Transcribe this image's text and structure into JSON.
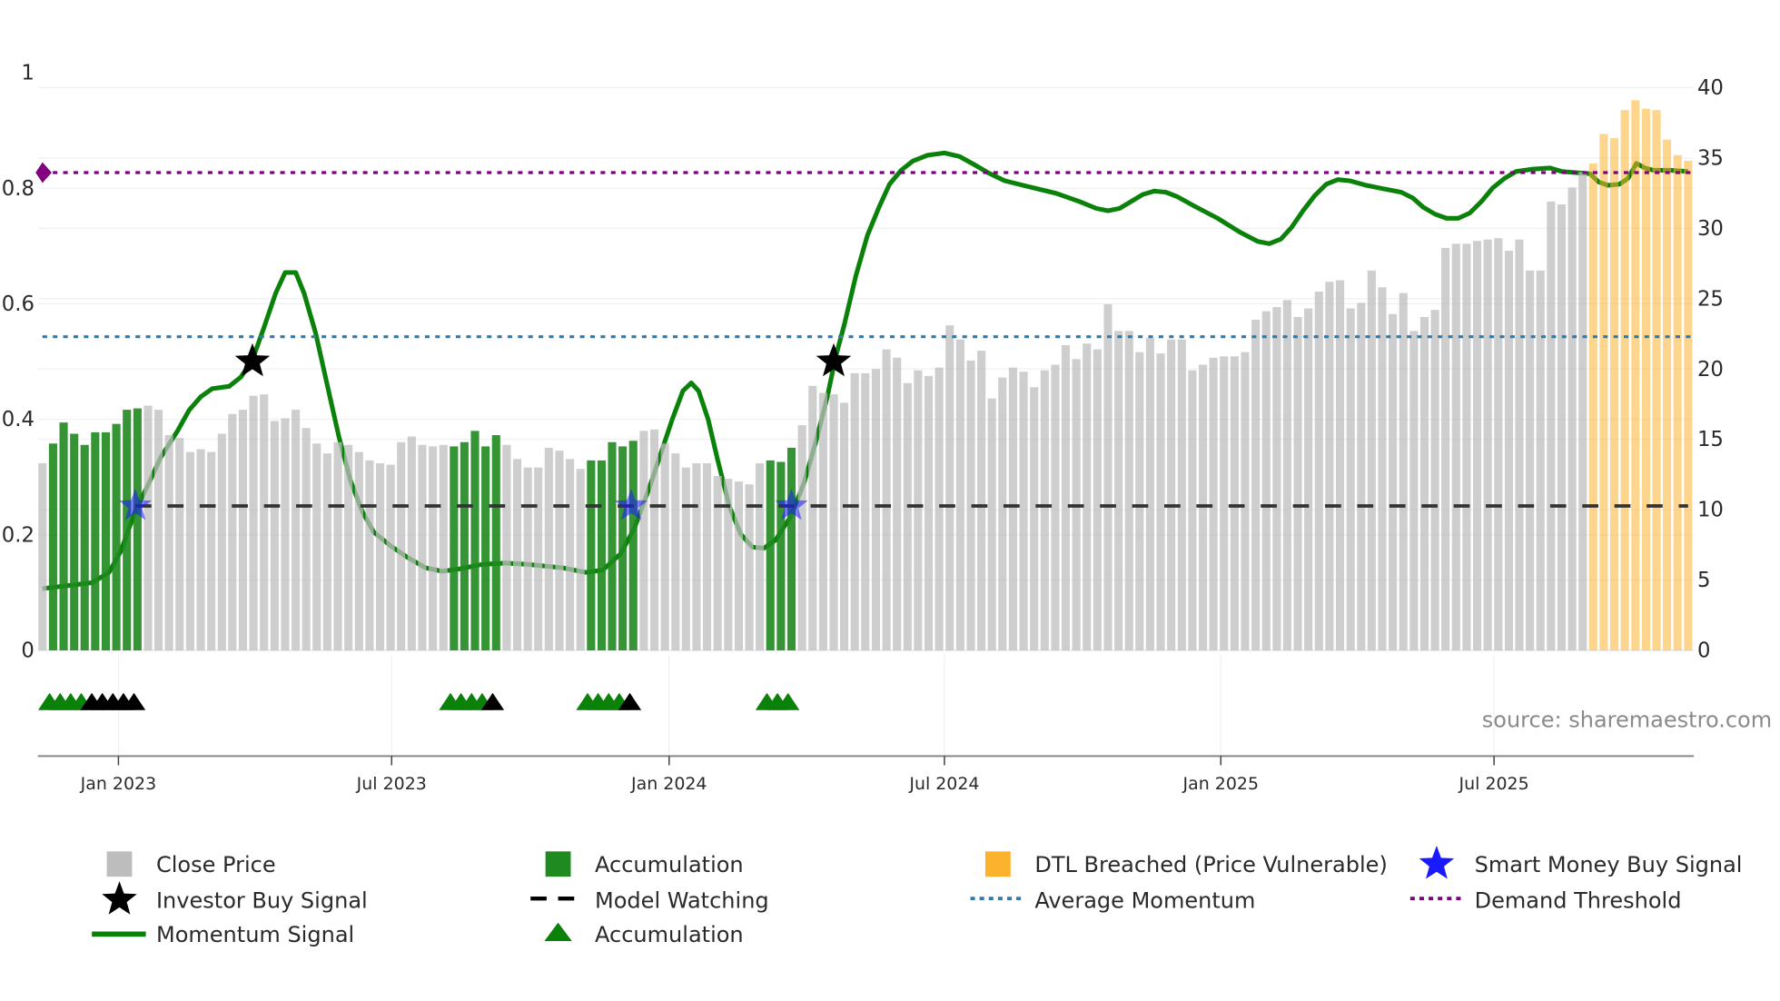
{
  "chart_data": {
    "type": "bar",
    "x_unit": "week index (1 = first weekly bar)",
    "left_axis": {
      "range": [
        0,
        1
      ],
      "ticks": [
        "0",
        "0.2",
        "0.4",
        "0.6",
        "0.8",
        "1"
      ]
    },
    "right_axis": {
      "range": [
        0,
        40
      ],
      "ticks": [
        "0",
        "5",
        "10",
        "15",
        "20",
        "25",
        "30",
        "35",
        "40"
      ]
    },
    "x_ticks": [
      {
        "label": "Jan 2023",
        "x": 8.2
      },
      {
        "label": "Jul 2023",
        "x": 34.1
      },
      {
        "label": "Jan 2024",
        "x": 60.4
      },
      {
        "label": "Jul 2024",
        "x": 86.5
      },
      {
        "label": "Jan 2025",
        "x": 112.7
      },
      {
        "label": "Jul 2025",
        "x": 138.6
      }
    ],
    "close_price": [
      13.3,
      14.7,
      16.2,
      15.4,
      14.6,
      15.5,
      15.5,
      16.1,
      17.1,
      17.2,
      17.4,
      17.1,
      15.3,
      15.1,
      14.1,
      14.3,
      14.1,
      15.4,
      16.8,
      17.1,
      18.1,
      18.2,
      16.3,
      16.5,
      17.1,
      15.8,
      14.7,
      14.0,
      14.8,
      14.6,
      14.1,
      13.5,
      13.3,
      13.2,
      14.8,
      15.2,
      14.6,
      14.5,
      14.6,
      14.5,
      14.8,
      15.6,
      14.5,
      15.3,
      14.6,
      13.6,
      13.0,
      13.0,
      14.4,
      14.2,
      13.6,
      12.9,
      13.5,
      13.5,
      14.8,
      14.5,
      14.9,
      15.6,
      15.7,
      14.7,
      14.0,
      13.0,
      13.3,
      13.3,
      12.4,
      12.2,
      12.0,
      11.8,
      13.3,
      13.5,
      13.4,
      14.4,
      16.0,
      18.8,
      18.3,
      18.2,
      17.6,
      19.7,
      19.7,
      20.0,
      21.4,
      20.8,
      19.0,
      19.9,
      19.5,
      20.1,
      23.1,
      22.1,
      20.6,
      21.3,
      17.9,
      19.4,
      20.1,
      19.8,
      18.7,
      19.9,
      20.3,
      21.7,
      20.7,
      21.8,
      21.4,
      24.6,
      22.7,
      22.7,
      21.2,
      22.2,
      21.1,
      22.1,
      22.1,
      19.9,
      20.3,
      20.8,
      20.9,
      20.9,
      21.2,
      23.5,
      24.1,
      24.4,
      24.9,
      23.7,
      24.3,
      25.5,
      26.2,
      26.3,
      24.3,
      24.7,
      27.0,
      25.8,
      23.9,
      25.4,
      22.7,
      23.7,
      24.2,
      28.6,
      28.9,
      28.9,
      29.1,
      29.2,
      29.3,
      28.4,
      29.2,
      27.0,
      27.0,
      31.9,
      31.7,
      32.9,
      34.0,
      34.6,
      36.7,
      36.4,
      38.4,
      39.1,
      38.5,
      38.4,
      36.3,
      35.2,
      34.8
    ],
    "accumulation_weeks": [
      [
        2,
        10
      ],
      [
        40,
        44
      ],
      [
        53,
        57
      ],
      [
        70,
        72
      ]
    ],
    "dtl_breached_weeks": [
      [
        148,
        157
      ]
    ],
    "momentum_signal": [
      [
        1,
        0.107
      ],
      [
        5.7,
        0.117
      ],
      [
        7.3,
        0.135
      ],
      [
        8.4,
        0.171
      ],
      [
        9.8,
        0.241
      ],
      [
        11.1,
        0.29
      ],
      [
        12.2,
        0.334
      ],
      [
        13.8,
        0.38
      ],
      [
        14.9,
        0.416
      ],
      [
        16,
        0.439
      ],
      [
        17.1,
        0.453
      ],
      [
        18.7,
        0.457
      ],
      [
        19.8,
        0.473
      ],
      [
        20.9,
        0.503
      ],
      [
        22,
        0.559
      ],
      [
        23.1,
        0.618
      ],
      [
        24,
        0.654
      ],
      [
        25,
        0.654
      ],
      [
        25.8,
        0.618
      ],
      [
        26.9,
        0.549
      ],
      [
        28,
        0.459
      ],
      [
        29.1,
        0.37
      ],
      [
        30.2,
        0.294
      ],
      [
        31.3,
        0.241
      ],
      [
        32.4,
        0.205
      ],
      [
        34,
        0.181
      ],
      [
        35.6,
        0.161
      ],
      [
        37.3,
        0.143
      ],
      [
        38.9,
        0.137
      ],
      [
        40.5,
        0.141
      ],
      [
        42.7,
        0.149
      ],
      [
        44.9,
        0.151
      ],
      [
        47,
        0.149
      ],
      [
        50.3,
        0.143
      ],
      [
        52.5,
        0.135
      ],
      [
        54.1,
        0.139
      ],
      [
        55.8,
        0.167
      ],
      [
        57.1,
        0.211
      ],
      [
        58.5,
        0.28
      ],
      [
        59.6,
        0.34
      ],
      [
        60.7,
        0.4
      ],
      [
        61.7,
        0.449
      ],
      [
        62.5,
        0.463
      ],
      [
        63.2,
        0.449
      ],
      [
        64.1,
        0.4
      ],
      [
        65,
        0.33
      ],
      [
        66.1,
        0.25
      ],
      [
        67.2,
        0.201
      ],
      [
        68.3,
        0.179
      ],
      [
        69.4,
        0.177
      ],
      [
        70.5,
        0.191
      ],
      [
        71.9,
        0.231
      ],
      [
        73.2,
        0.29
      ],
      [
        74.3,
        0.36
      ],
      [
        75.4,
        0.439
      ],
      [
        76.2,
        0.509
      ],
      [
        77,
        0.563
      ],
      [
        78.1,
        0.648
      ],
      [
        79.2,
        0.718
      ],
      [
        80.3,
        0.767
      ],
      [
        81.3,
        0.807
      ],
      [
        82.4,
        0.831
      ],
      [
        83.5,
        0.847
      ],
      [
        84.9,
        0.857
      ],
      [
        86.5,
        0.861
      ],
      [
        87.9,
        0.855
      ],
      [
        89.5,
        0.839
      ],
      [
        90.6,
        0.827
      ],
      [
        92.2,
        0.813
      ],
      [
        94.4,
        0.803
      ],
      [
        97.1,
        0.791
      ],
      [
        99.3,
        0.777
      ],
      [
        100.9,
        0.765
      ],
      [
        102,
        0.761
      ],
      [
        103.1,
        0.765
      ],
      [
        104.2,
        0.777
      ],
      [
        105.3,
        0.789
      ],
      [
        106.4,
        0.795
      ],
      [
        107.5,
        0.793
      ],
      [
        108.6,
        0.785
      ],
      [
        110.2,
        0.769
      ],
      [
        112.4,
        0.748
      ],
      [
        114.5,
        0.724
      ],
      [
        116.2,
        0.708
      ],
      [
        117.3,
        0.704
      ],
      [
        118.4,
        0.712
      ],
      [
        119.4,
        0.732
      ],
      [
        120.5,
        0.761
      ],
      [
        121.6,
        0.787
      ],
      [
        122.7,
        0.807
      ],
      [
        123.8,
        0.815
      ],
      [
        124.9,
        0.813
      ],
      [
        126.5,
        0.805
      ],
      [
        128.1,
        0.799
      ],
      [
        129.8,
        0.793
      ],
      [
        130.9,
        0.783
      ],
      [
        131.9,
        0.767
      ],
      [
        133,
        0.755
      ],
      [
        134.1,
        0.748
      ],
      [
        135.2,
        0.748
      ],
      [
        136.3,
        0.757
      ],
      [
        137.4,
        0.777
      ],
      [
        138.5,
        0.801
      ],
      [
        139.6,
        0.817
      ],
      [
        140.7,
        0.829
      ],
      [
        142.3,
        0.833
      ],
      [
        143.9,
        0.835
      ],
      [
        145,
        0.829
      ],
      [
        146.3,
        0.827
      ],
      [
        147.7,
        0.825
      ],
      [
        148.5,
        0.811
      ],
      [
        149.4,
        0.805
      ],
      [
        150.5,
        0.807
      ],
      [
        151.3,
        0.817
      ],
      [
        152.1,
        0.843
      ],
      [
        152.9,
        0.835
      ],
      [
        153.7,
        0.831
      ],
      [
        155.3,
        0.831
      ],
      [
        157,
        0.829
      ]
    ],
    "demand_threshold": 0.827,
    "average_momentum": 0.543,
    "model_watching": {
      "value": 0.25,
      "from_week": 9.8,
      "to_week": 157
    },
    "investor_buy_signals": [
      [
        20.9,
        0.5
      ],
      [
        76,
        0.5
      ]
    ],
    "smart_money_buy_signals": [
      [
        9.8,
        0.25
      ],
      [
        56.8,
        0.25
      ],
      [
        72,
        0.25
      ]
    ],
    "triangle_markers": {
      "accumulation": [
        2,
        3,
        4,
        5,
        40,
        41,
        42,
        43,
        53,
        54,
        55,
        56,
        70,
        71,
        72
      ],
      "black": [
        6,
        7,
        8,
        9,
        10,
        44,
        57
      ]
    },
    "colors": {
      "close": "#bdbdbd",
      "accumulation": "#1f8a1f",
      "dtl": "#fdb22e",
      "momentum": "#0a820a",
      "smart_money": "#1a1aff",
      "investor": "#000000",
      "avg_momentum": "#2e7bb0",
      "demand": "#800080",
      "watching": "#333333"
    },
    "source": "source: sharemaestro.com",
    "legend": [
      {
        "label": "Close Price",
        "icon": "gray-square"
      },
      {
        "label": "Accumulation",
        "icon": "green-square"
      },
      {
        "label": "DTL Breached (Price Vulnerable)",
        "icon": "orange-square"
      },
      {
        "label": "Smart Money Buy Signal",
        "icon": "blue-star"
      },
      {
        "label": "Investor Buy Signal",
        "icon": "black-star"
      },
      {
        "label": "Model Watching",
        "icon": "black-dash"
      },
      {
        "label": "Average Momentum",
        "icon": "blue-dot-line"
      },
      {
        "label": "Demand Threshold",
        "icon": "purple-dot-line"
      },
      {
        "label": "Momentum Signal",
        "icon": "green-line"
      },
      {
        "label": "Accumulation",
        "icon": "green-triangle"
      }
    ]
  }
}
